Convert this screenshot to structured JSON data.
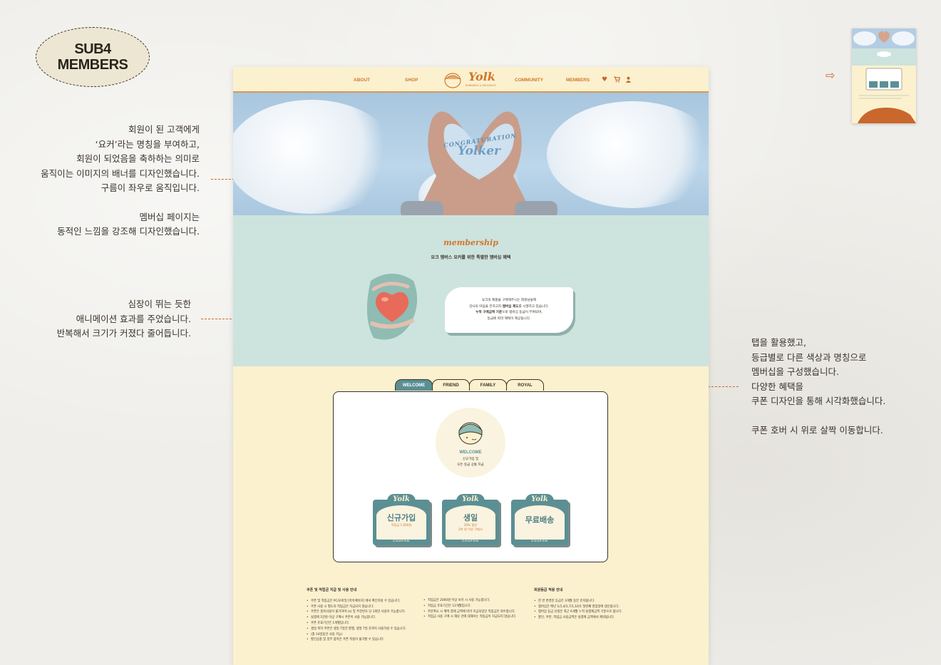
{
  "badge": {
    "line1": "SUB4",
    "line2": "MEMBERS"
  },
  "annotations": {
    "banner": [
      "회원이 된 고객에게",
      "‘요커’라는 명칭을 부여하고,",
      "회원이 되었음을 축하하는 의미로",
      "움직이는 이미지의 배너를 디자인했습니다.",
      "구름이 좌우로 움직입니다."
    ],
    "membership_page": [
      "멤버십 페이지는",
      "동적인 느낌을 강조해 디자인했습니다."
    ],
    "heart": [
      "심장이 뛰는 듯한",
      "애니메이션 효과를 주었습니다.",
      "반복해서 크기가 커졌다 줄어듭니다."
    ],
    "tabs": [
      "탭을 활용했고,",
      "등급별로 다른 색상과 명칭으로",
      "멤버십을 구성했습니다.",
      "다양한 혜택을",
      "쿠폰 디자인을 통해 시각화했습니다."
    ],
    "coupon_hover": "쿠폰 호버 시 위로 살짝 이동합니다."
  },
  "nav": {
    "about": "ABOUT",
    "shop": "SHOP",
    "logo": "Yolk",
    "logo_sub": "RUBBINGS & SNOGGLES",
    "community": "COMMUNITY",
    "members": "MEMBERS"
  },
  "hero": {
    "line1": "CONGRATURATION",
    "line2": "Yolker"
  },
  "membership": {
    "title": "membership",
    "subtitle": "요크 멤버스 요커를 위한 특별한 멤버십 혜택",
    "bubble_l1": "요크의 제품을 구매해주시는 회원님들께",
    "bubble_l2a": "감사의 마음을 전하고자 ",
    "bubble_l2b": "멤버십 제도",
    "bubble_l2c": "를 시행하고 있습니다.",
    "bubble_l3a": "누적 구매금액 기준",
    "bubble_l3b": "으로 멤버십 등급이 부여되며,",
    "bubble_l4": "등급에 따라 혜택이 제공됩니다."
  },
  "tabs": [
    "WELCOME",
    "FRIEND",
    "FAMILY",
    "ROYAL"
  ],
  "grade": {
    "name": "WELCOME",
    "desc1": "신규가입 및",
    "desc2": "모든 등급 공통 지급"
  },
  "coupons": [
    {
      "brand": "Yolk",
      "title": "신규가입",
      "line1": "적립금 1,000원",
      "line2": "",
      "stamp": "COUPON"
    },
    {
      "brand": "Yolk",
      "title": "생일",
      "line1": "20% 할인",
      "line2": "2만 원 이상 구매시",
      "stamp": "COUPON"
    },
    {
      "brand": "Yolk",
      "title": "무료배송",
      "line1": "",
      "line2": "",
      "stamp": "COUPON"
    }
  ],
  "notes": {
    "col1_title": "쿠폰 및 적립금 지급 및 사용 안내",
    "col1": [
      "쿠폰 및 적립금은 PC/모바일 [마이페이지] 에서 확인하실 수 있습니다.",
      "쿠폰 사용 시 별도의 적립금은 지급되지 않습니다.",
      "쿠폰은 중복사용이 불가하며 (x) 및 주문번호 당 1회만 사용이 가능합니다.",
      "실결제 1만원 이상 구매시 쿠폰이 사용 가능합니다.",
      "쿠폰 유효기간은 1개월입니다.",
      "생일 축하 쿠폰은 생일 7일전 발행, 생일 7일 후까지 사용하실 수 있습니다.",
      "(총 14일동안 사용 가능)",
      "할인상품 및 일부 품목은 쿠폰 적용이 불가할 수 있습니다."
    ],
    "col2": [
      "적립금은 2000원 이상 보유 시 사용 가능합니다.",
      "적립금 유효기간은 12개월입니다.",
      "주문취소 시 혜택 결제 금액에 따라 지급되었던 적립금은 회수합니다.",
      "적립금 사용 구매 시 해당 건에 대해서는 적립금이 지급되지 않습니다."
    ],
    "col3_title": "회원등급 적용 안내",
    "col3": [
      "한 번 변경된 등급은 3개월 동안 유지됩니다.",
      "멤버십은 매년 1/1,4/1,7/1,10/1 첫번째 영업일에 갱신됩니다.",
      "멤버십 등급 산정은 최근 6개월 누적 실결제금액 기준으로 봅니다.",
      "할인, 쿠폰, 적립금 사용금액은 실결제 금액에서 제외됩니다."
    ]
  }
}
